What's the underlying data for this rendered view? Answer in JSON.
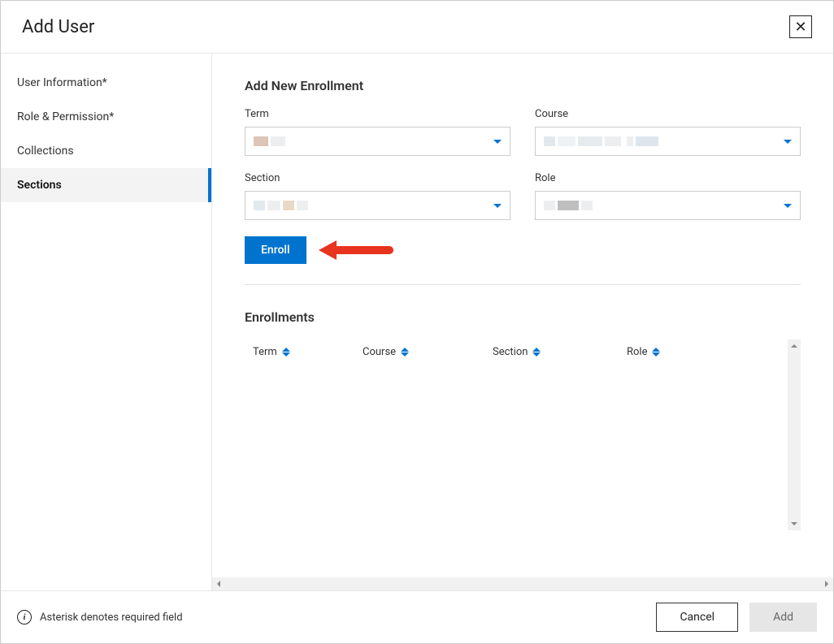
{
  "header": {
    "title": "Add User"
  },
  "sidebar": {
    "items": [
      {
        "label": "User Information*",
        "active": false
      },
      {
        "label": "Role & Permission*",
        "active": false
      },
      {
        "label": "Collections",
        "active": false
      },
      {
        "label": "Sections",
        "active": true
      }
    ]
  },
  "form": {
    "title": "Add New Enrollment",
    "term_label": "Term",
    "course_label": "Course",
    "section_label": "Section",
    "role_label": "Role",
    "enroll_button": "Enroll"
  },
  "enrollments": {
    "title": "Enrollments",
    "columns": {
      "term": "Term",
      "course": "Course",
      "section": "Section",
      "role": "Role"
    }
  },
  "footer": {
    "note": "Asterisk denotes required field",
    "cancel": "Cancel",
    "add": "Add"
  }
}
